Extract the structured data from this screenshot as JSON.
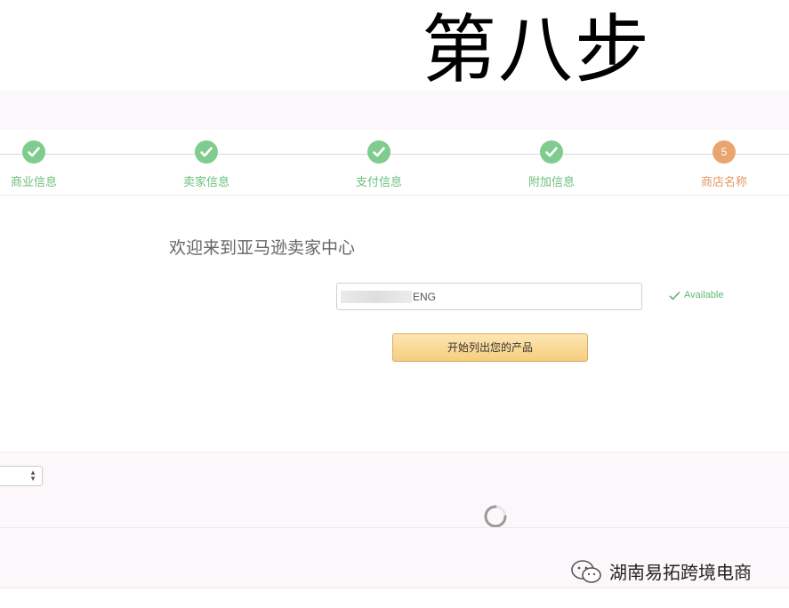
{
  "overlay": {
    "title": "第八步"
  },
  "stepper": {
    "steps": [
      {
        "label": "商业信息",
        "state": "done"
      },
      {
        "label": "卖家信息",
        "state": "done"
      },
      {
        "label": "支付信息",
        "state": "done"
      },
      {
        "label": "附加信息",
        "state": "done"
      },
      {
        "label": "商店名称",
        "state": "current",
        "number": "5"
      }
    ],
    "colors": {
      "done": "#7fcc8e",
      "current": "#e9a56f"
    }
  },
  "main": {
    "welcome": "欢迎来到亚马逊卖家中心",
    "store_name_value": "ENG",
    "availability": "Available",
    "start_button_label": "开始列出您的产品"
  },
  "watermark": {
    "text": "湖南易拓跨境电商",
    "icon": "wechat-icon"
  }
}
